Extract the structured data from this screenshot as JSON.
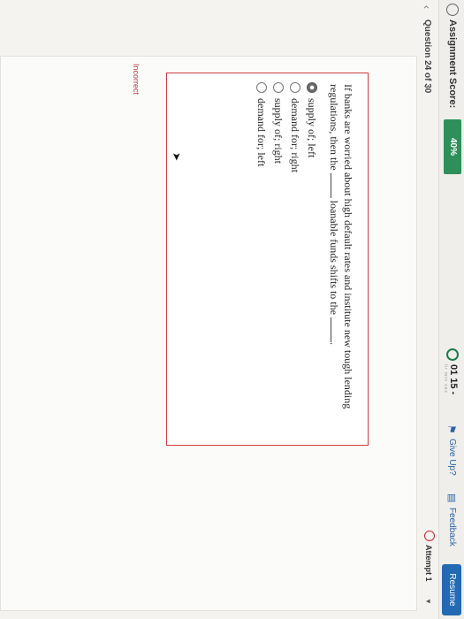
{
  "header": {
    "score_label": "Assignment Score:",
    "score_value": "40%",
    "timer": "01 15",
    "timer_suffix": "-",
    "timer_units": "hr  min  sec",
    "give_up_label": "Give Up?",
    "feedback_label": "Feedback",
    "resume_label": "Resume"
  },
  "nav": {
    "question_label": "Question 24 of 30",
    "attempt_label": "Attempt 1"
  },
  "question": {
    "text_part1": "If banks are worried about high default rates and institute new tough lending regulations, then the",
    "text_part2": "loanable funds shifts to the",
    "text_end": ".",
    "options": [
      {
        "label": "supply of; left",
        "selected": true
      },
      {
        "label": "demand for; right",
        "selected": false
      },
      {
        "label": "supply of; right",
        "selected": false
      },
      {
        "label": "demand for; left",
        "selected": false
      }
    ],
    "result": "Incorrect"
  },
  "icons": {
    "prev": "chevron-left-icon",
    "next": "chevron-right-icon",
    "timer": "clock-icon",
    "give_up": "flag-icon",
    "feedback": "comment-icon",
    "attempt": "no-entry-icon"
  },
  "colors": {
    "score_badge": "#2f8f5b",
    "resume_button": "#2369b3",
    "incorrect_border": "#cf3c3c",
    "link": "#2a62a8"
  }
}
